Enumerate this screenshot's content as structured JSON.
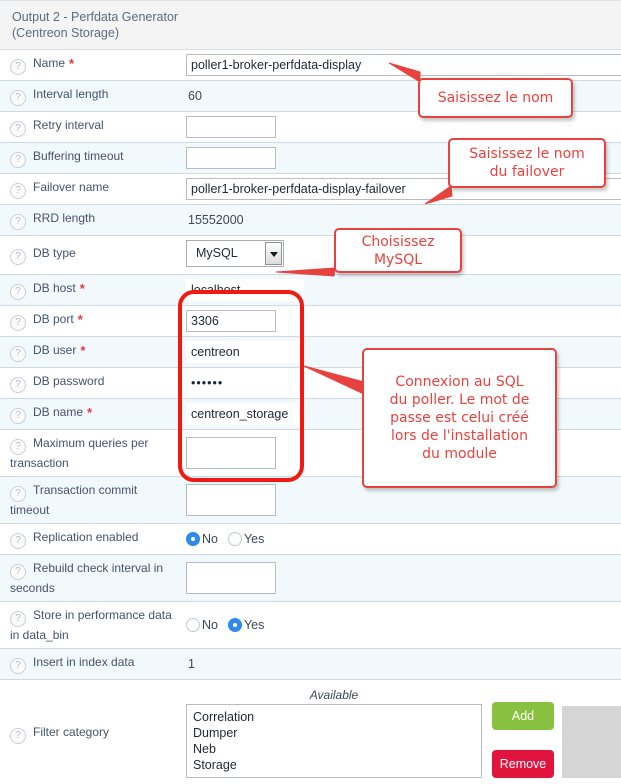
{
  "section": {
    "title_line1": "Output 2 - Perfdata Generator",
    "title_line2": "(Centreon Storage)"
  },
  "help_icon_glyph": "?",
  "required_marker": "*",
  "fields": {
    "name": {
      "label": "Name",
      "value": "poller1-broker-perfdata-display"
    },
    "interval_length": {
      "label": "Interval length",
      "value": "60"
    },
    "retry_interval": {
      "label": "Retry interval",
      "value": ""
    },
    "buffering_timeout": {
      "label": "Buffering timeout",
      "value": ""
    },
    "failover_name": {
      "label": "Failover name",
      "value": "poller1-broker-perfdata-display-failover"
    },
    "rrd_length": {
      "label": "RRD length",
      "value": "15552000"
    },
    "db_type": {
      "label": "DB type",
      "value": "MySQL"
    },
    "db_host": {
      "label": "DB host",
      "value": "localhost"
    },
    "db_port": {
      "label": "DB port",
      "value": "3306"
    },
    "db_user": {
      "label": "DB user",
      "value": "centreon"
    },
    "db_password": {
      "label": "DB password",
      "value": "••••••"
    },
    "db_name": {
      "label": "DB name",
      "value": "centreon_storage"
    },
    "max_queries": {
      "label": "Maximum queries per transaction",
      "value": ""
    },
    "transaction_commit_timeout": {
      "label": "Transaction commit timeout",
      "value": ""
    },
    "replication_enabled": {
      "label": "Replication enabled",
      "selected": "No"
    },
    "rebuild_check_interval": {
      "label": "Rebuild check interval in seconds",
      "value": ""
    },
    "store_in_data_bin": {
      "label": "Store in performance data in data_bin",
      "selected": "Yes"
    },
    "insert_in_index_data": {
      "label": "Insert in index data",
      "value": "1"
    },
    "filter_category": {
      "label": "Filter category"
    }
  },
  "radio_options": {
    "no": "No",
    "yes": "Yes"
  },
  "dual_list": {
    "available_title": "Available",
    "available_items": [
      "Correlation",
      "Dumper",
      "Neb",
      "Storage"
    ],
    "add_label": "Add",
    "remove_label": "Remove"
  },
  "annotations": [
    {
      "id": "name-callout",
      "text": "Saisissez le nom"
    },
    {
      "id": "failover-callout",
      "text_line1": "Saisissez le nom",
      "text_line2": "du failover"
    },
    {
      "id": "dbtype-callout",
      "text_line1": "Choisissez",
      "text_line2": "MySQL"
    },
    {
      "id": "sql-callout",
      "text_line1": "Connexion au SQL",
      "text_line2": "du poller. Le mot de",
      "text_line3": "passe est celui créé",
      "text_line4": "lors de l'installation",
      "text_line5": "du module"
    }
  ],
  "colors": {
    "annotation_red": "#e8423f",
    "highlight_box_red": "#f01a13",
    "add_green": "#88c040",
    "remove_red": "#e0143c",
    "radio_blue": "#2f8ae8",
    "row_alt": "#f1f9fd",
    "header_bg": "#f4f4f4"
  }
}
